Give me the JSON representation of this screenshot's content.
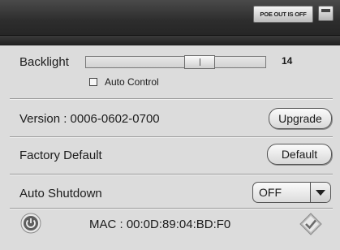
{
  "header": {
    "poe_status": "POE OUT IS OFF"
  },
  "backlight": {
    "label": "Backlight",
    "value": "14",
    "level_fraction": 0.66,
    "auto_control_label": "Auto Control",
    "auto_control_checked": false
  },
  "version": {
    "text": "Version : 0006-0602-0700",
    "upgrade_label": "Upgrade"
  },
  "factory": {
    "label": "Factory Default",
    "button_label": "Default"
  },
  "shutdown": {
    "label": "Auto Shutdown",
    "selected": "OFF"
  },
  "footer": {
    "mac": "MAC : 00:0D:89:04:BD:F0"
  },
  "icons": {
    "power": "power-icon",
    "confirm": "checkmark-icon",
    "close": "close-icon"
  }
}
